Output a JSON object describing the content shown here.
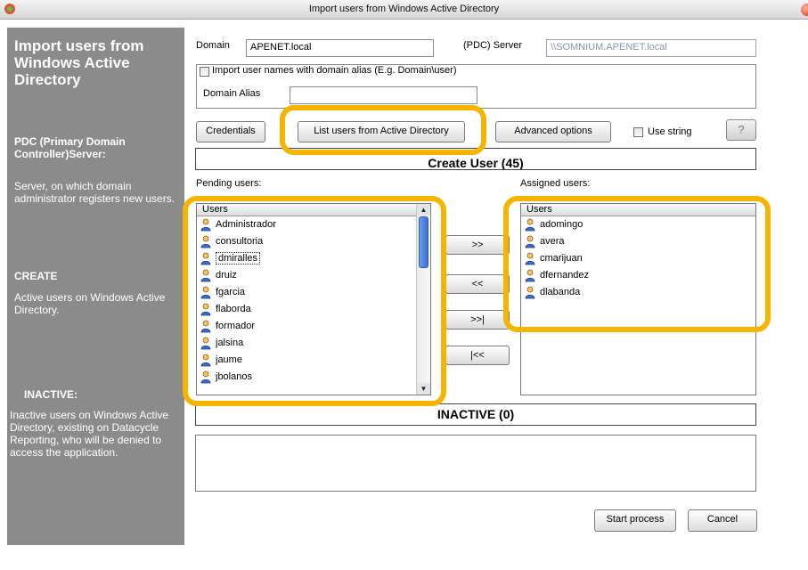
{
  "window": {
    "title": "Import users from Windows Active Directory"
  },
  "sidebar": {
    "title": "Import users from Windows Active Directory",
    "pdc_heading": "PDC (Primary Domain Controller)Server:",
    "pdc_text": "Server, on which domain administrator registers new users.",
    "create_heading": "CREATE",
    "create_text": "Active users on Windows Active Directory.",
    "inactive_heading": "INACTIVE:",
    "inactive_text": "Inactive users on Windows Active Directory, existing on Datacycle Reporting, who will be denied to access the application."
  },
  "form": {
    "domain_label": "Domain",
    "domain_value": "APENET.local",
    "pdc_label": "(PDC) Server",
    "pdc_value": "\\\\SOMNIUM.APENET.local",
    "alias_checkbox_label": "Import user names with domain alias (E.g. Domain\\user)",
    "alias_label": "Domain Alias",
    "alias_value": ""
  },
  "toolbar": {
    "credentials": "Credentials",
    "list_users": "List users from Active Directory",
    "advanced": "Advanced options",
    "use_string": "Use string",
    "help": "?"
  },
  "create_bar": "Create User (45)",
  "pending": {
    "label": "Pending users:",
    "header": "Users",
    "items": [
      "Administrador",
      "consultoria",
      "dmiralles",
      "druiz",
      "fgarcia",
      "flaborda",
      "formador",
      "jalsina",
      "jaume",
      "jbolanos"
    ]
  },
  "assigned": {
    "label": "Assigned users:",
    "header": "Users",
    "items": [
      "adomingo",
      "avera",
      "cmarijuan",
      "dfernandez",
      "dlabanda"
    ]
  },
  "move_buttons": {
    "add": ">>",
    "remove": "<<",
    "add_all": ">>|",
    "remove_all": "|<<"
  },
  "inactive_bar": "INACTIVE (0)",
  "footer": {
    "start": "Start process",
    "cancel": "Cancel"
  }
}
